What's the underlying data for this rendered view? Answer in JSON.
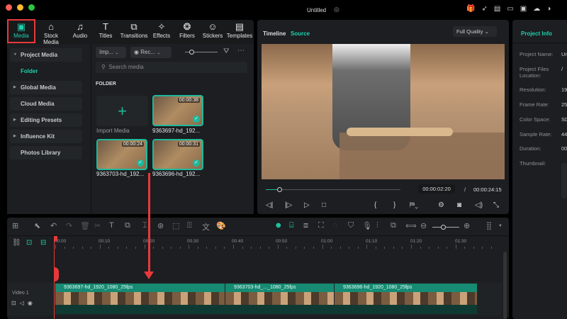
{
  "window": {
    "title": "Untitled"
  },
  "tabs": [
    {
      "label": "Media",
      "icon": "media-icon"
    },
    {
      "label": "Stock Media",
      "icon": "store-icon"
    },
    {
      "label": "Audio",
      "icon": "music-icon"
    },
    {
      "label": "Titles",
      "icon": "text-icon"
    },
    {
      "label": "Transitions",
      "icon": "transition-icon"
    },
    {
      "label": "Effects",
      "icon": "effects-icon"
    },
    {
      "label": "Filters",
      "icon": "filters-icon"
    },
    {
      "label": "Stickers",
      "icon": "sticker-icon"
    },
    {
      "label": "Templates",
      "icon": "template-icon"
    }
  ],
  "sidebar": {
    "items": [
      {
        "label": "Project Media"
      },
      {
        "label": "Folder"
      },
      {
        "label": "Global Media"
      },
      {
        "label": "Cloud Media"
      },
      {
        "label": "Editing Presets"
      },
      {
        "label": "Influence Kit"
      },
      {
        "label": "Photos Library"
      }
    ]
  },
  "media": {
    "import_dropdown": "Imp...",
    "record_dropdown": "Rec...",
    "search_placeholder": "Search media",
    "folder_label": "FOLDER",
    "import_label": "Import Media",
    "items": [
      {
        "name": "9363697-hd_192...",
        "duration": "00:00:38"
      },
      {
        "name": "9363703-hd_192...",
        "duration": "00:00:24"
      },
      {
        "name": "9363696-hd_192...",
        "duration": "00:00:31"
      }
    ]
  },
  "preview": {
    "tab_timeline": "Timeline",
    "tab_source": "Source",
    "quality": "Full Quality",
    "current_time": "00:00:02:20",
    "separator": "/",
    "total_time": "00:00:24:15",
    "progress_percent": 10
  },
  "project_info": {
    "title": "Project Info",
    "rows": [
      {
        "label": "Project Name:",
        "value": "Ur"
      },
      {
        "label": "Project Files Location:",
        "value": "/"
      },
      {
        "label": "Resolution:",
        "value": "19"
      },
      {
        "label": "Frame Rate:",
        "value": "25"
      },
      {
        "label": "Color Space:",
        "value": "SD"
      },
      {
        "label": "Sample Rate:",
        "value": "44"
      },
      {
        "label": "Duration:",
        "value": "00"
      },
      {
        "label": "Thumbnail:",
        "value": ""
      }
    ]
  },
  "timeline": {
    "ruler": [
      "00:00",
      "00:10",
      "00:20",
      "00:30",
      "00:40",
      "00:50",
      "01:00",
      "01:10",
      "01:20",
      "01:30"
    ],
    "track_label": "Video 1",
    "clips": [
      {
        "name": "9363697-hd_1920_1080_25fps"
      },
      {
        "name": "9363703-hd_..._1080_25fps"
      },
      {
        "name": "9363696-hd_1920_1080_25fps"
      }
    ]
  },
  "colors": {
    "accent": "#1fb89a",
    "highlight": "#e8393a"
  }
}
